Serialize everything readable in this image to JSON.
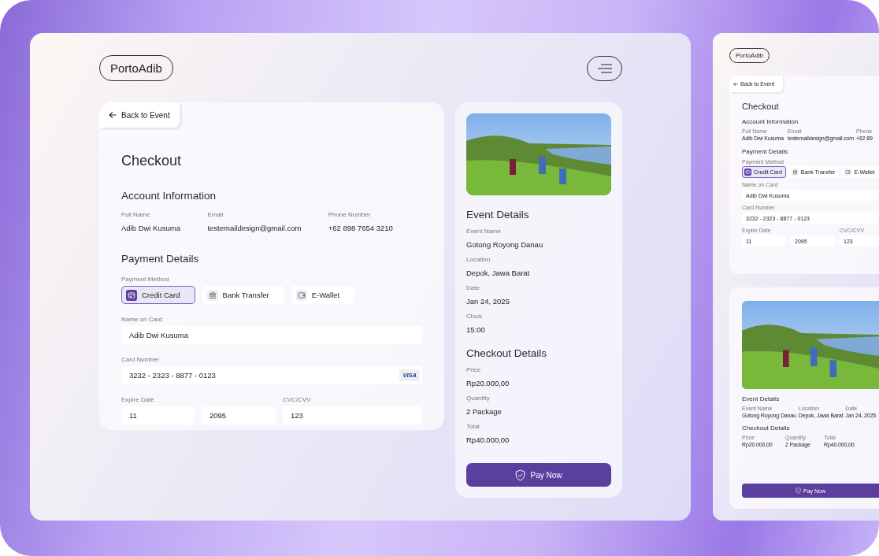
{
  "brand": "PortoAdib",
  "back_link": "Back to Event",
  "checkout": {
    "title": "Checkout",
    "account_heading": "Account Information",
    "account_fields": [
      {
        "label": "Full Name",
        "value": "Adib Dwi Kusuma"
      },
      {
        "label": "Email",
        "value": "testemaildesign@gmail.com"
      },
      {
        "label": "Phone Number",
        "value": "+62 898 7654 3210"
      }
    ],
    "payment_heading": "Payment Details",
    "method_label": "Payment Method",
    "methods": [
      {
        "label": "Credit Card",
        "kind": "card",
        "selected": true
      },
      {
        "label": "Bank Transfer",
        "kind": "bank",
        "selected": false
      },
      {
        "label": "E-Wallet",
        "kind": "wallet",
        "selected": false
      }
    ],
    "name_label": "Name on Card",
    "name_value": "Adib Dwi Kusuma",
    "card_label": "Card Number",
    "card_value": "3232 - 2323 - 8877 - 0123",
    "card_badge": "VISA",
    "expire_label": "Expire Date",
    "month": "11",
    "year": "2095",
    "cvc_label": "CVC/CVV",
    "cvc_value": "123"
  },
  "summary": {
    "event_heading": "Event Details",
    "event_fields": [
      {
        "label": "Event Name",
        "value": "Gotong Royong Danau"
      },
      {
        "label": "Location",
        "value": "Depok, Jawa Barat"
      },
      {
        "label": "Date",
        "value": "Jan 24, 2025"
      },
      {
        "label": "Clock",
        "value": "15:00"
      }
    ],
    "checkout_heading": "Checkout Details",
    "checkout_fields": [
      {
        "label": "Price",
        "value": "Rp20.000,00"
      },
      {
        "label": "Quantity",
        "value": "2 Package"
      },
      {
        "label": "Total",
        "value": "Rp40.000,00"
      }
    ],
    "pay_button": "Pay Now"
  },
  "preview": {
    "brand": "PortoAdib",
    "back_link": "Back to Event",
    "title": "Checkout",
    "account_heading": "Account Information",
    "account_fields": [
      {
        "label": "Full Name",
        "value": "Adib Dwi Kusuma"
      },
      {
        "label": "Email",
        "value": "testemaildesign@gmail.com"
      },
      {
        "label": "Phone",
        "value": "+62 89"
      }
    ],
    "payment_heading": "Payment Details",
    "method_label": "Payment Method",
    "methods": [
      {
        "label": "Credit Card",
        "kind": "card",
        "selected": true
      },
      {
        "label": "Bank Transfer",
        "kind": "bank",
        "selected": false
      },
      {
        "label": "E-Wallet",
        "kind": "wallet",
        "selected": false
      }
    ],
    "name_label": "Name on Card",
    "name_value": "Adib Dwi Kusuma",
    "card_label": "Card Number",
    "card_value": "3232 - 2323 - 8877 - 0123",
    "expire_label": "Expire Date",
    "month": "11",
    "year": "2095",
    "cvc_label": "CVC/CVV",
    "cvc_value": "123",
    "event_heading": "Event Details",
    "event_fields": [
      {
        "label": "Event Name",
        "value": "Gotong Royong Danau"
      },
      {
        "label": "Location",
        "value": "Depok, Jawa Barat"
      },
      {
        "label": "Date",
        "value": "Jan 24, 2025"
      }
    ],
    "checkout_heading": "Checkout Details",
    "checkout_fields": [
      {
        "label": "Price",
        "value": "Rp20.000,00"
      },
      {
        "label": "Quantity",
        "value": "2 Package"
      },
      {
        "label": "Total",
        "value": "Rp40.000,00"
      }
    ],
    "pay_button": "Pay Now"
  }
}
